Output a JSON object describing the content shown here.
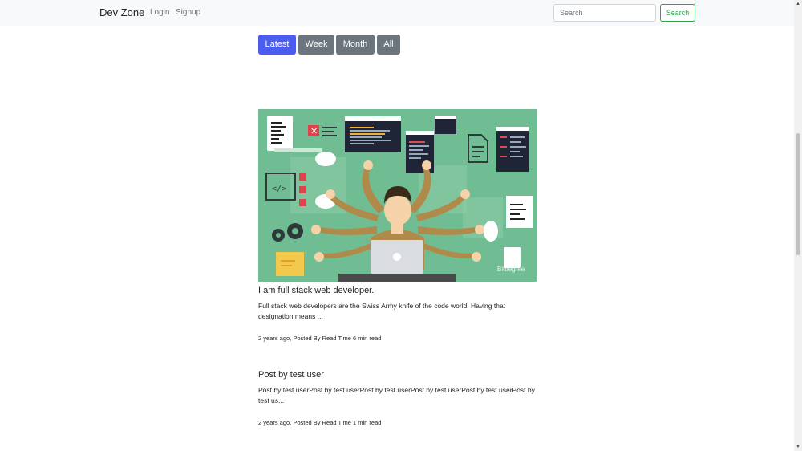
{
  "navbar": {
    "brand": "Dev Zone",
    "login": "Login",
    "signup": "Signup",
    "search_placeholder": "Search",
    "search_button": "Search"
  },
  "filters": {
    "active": "Latest",
    "items": [
      "Latest",
      "Week",
      "Month",
      "All"
    ]
  },
  "colors": {
    "active_filter": "#4c5cf0",
    "inactive_filter": "#6c757d",
    "navbar_bg": "#f8f9fa",
    "search_button": "#28a745"
  },
  "posts": [
    {
      "title": "I am full stack web developer.",
      "excerpt": "Full stack web developers are the Swiss Army knife of the code world. Having that designation means ...",
      "meta": "2 years ago, Posted By Read Time 6 min read",
      "image_watermark": "Bitdegree"
    },
    {
      "title": "Post by test user",
      "excerpt": "Post by test userPost by test userPost by test userPost by test userPost by test userPost by test us...",
      "meta": "2 years ago, Posted By Read Time 1 min read"
    }
  ]
}
